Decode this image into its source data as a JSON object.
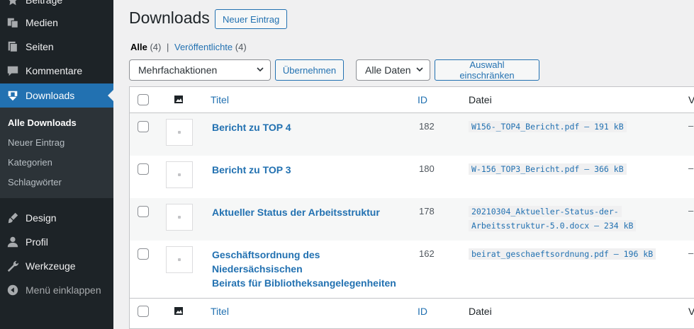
{
  "sidebar": {
    "items": [
      {
        "label": "Beiträge",
        "icon": "pin-icon"
      },
      {
        "label": "Medien",
        "icon": "media-icon"
      },
      {
        "label": "Seiten",
        "icon": "pages-icon"
      },
      {
        "label": "Kommentare",
        "icon": "comment-icon"
      },
      {
        "label": "Downloads",
        "icon": "download-icon"
      },
      {
        "label": "Design",
        "icon": "brush-icon"
      },
      {
        "label": "Profil",
        "icon": "user-icon"
      },
      {
        "label": "Werkzeuge",
        "icon": "wrench-icon"
      },
      {
        "label": "Menü einklappen",
        "icon": "collapse-icon"
      }
    ],
    "submenu": [
      "Alle Downloads",
      "Neuer Eintrag",
      "Kategorien",
      "Schlagwörter"
    ]
  },
  "header": {
    "title": "Downloads",
    "add_new": "Neuer Eintrag"
  },
  "filters": {
    "all_label": "Alle",
    "all_count": "(4)",
    "separator": "|",
    "published_label": "Veröffentlichte",
    "published_count": "(4)",
    "bulk_select": "Mehrfachaktionen",
    "apply": "Übernehmen",
    "date_select": "Alle Daten",
    "filter_button": "Auswahl einschränken"
  },
  "table": {
    "columns": {
      "title": "Titel",
      "id": "ID",
      "file": "Datei",
      "extra": "V"
    },
    "rows": [
      {
        "title": "Bericht zu TOP 4",
        "id": "182",
        "file": "W156-_TOP4_Bericht.pdf – 191 kB",
        "extra": "–"
      },
      {
        "title": "Bericht zu TOP 3",
        "id": "180",
        "file": "W-156_TOP3_Bericht.pdf – 366 kB",
        "extra": "–"
      },
      {
        "title": "Aktueller Status der Arbeitsstruktur",
        "id": "178",
        "file_line1": "20210304_Aktueller-Status-der-",
        "file_line2": "Arbeitsstruktur-5.0.docx – 234 kB",
        "extra": "–"
      },
      {
        "title_line1": "Geschäftsordnung des Niedersächsischen",
        "title_line2": "Beirats für Bibliotheksangelegenheiten",
        "id": "162",
        "file": "beirat_geschaeftsordnung.pdf – 196 kB",
        "extra": "–"
      }
    ]
  },
  "colors": {
    "accent": "#2271b1",
    "sidebar_bg": "#1d2327",
    "submenu_bg": "#2c3338"
  }
}
